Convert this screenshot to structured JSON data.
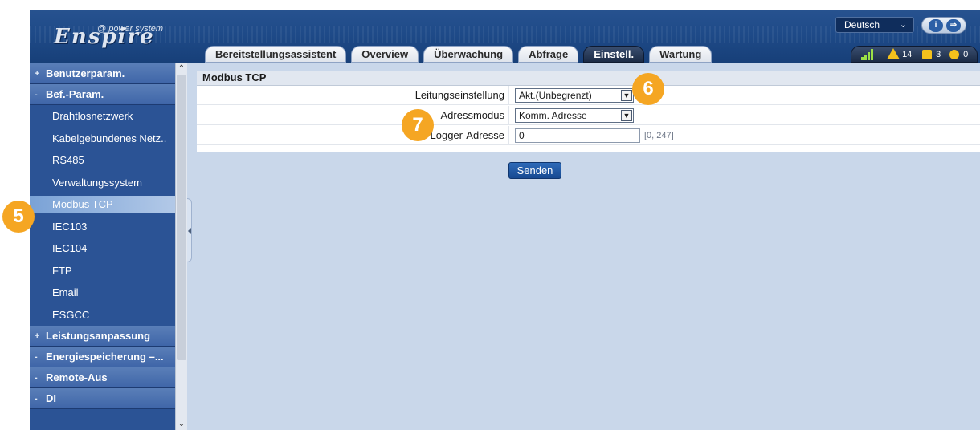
{
  "header": {
    "logo_text": "Enspire",
    "logo_sub": "@ power system",
    "language": "Deutsch",
    "tabs": [
      {
        "label": "Bereitstellungsassistent",
        "active": false
      },
      {
        "label": "Overview",
        "active": false
      },
      {
        "label": "Überwachung",
        "active": false
      },
      {
        "label": "Abfrage",
        "active": false
      },
      {
        "label": "Einstell.",
        "active": true
      },
      {
        "label": "Wartung",
        "active": false
      }
    ],
    "alarms": {
      "major": "14",
      "minor": "3",
      "info": "0"
    }
  },
  "sidebar": {
    "items": [
      {
        "type": "section",
        "label": "Benutzerparam.",
        "mark": "+"
      },
      {
        "type": "section",
        "label": "Bef.-Param.",
        "mark": "-"
      },
      {
        "type": "sub",
        "label": "Drahtlosnetzwerk"
      },
      {
        "type": "sub",
        "label": "Kabelgebundenes Netz.."
      },
      {
        "type": "sub",
        "label": "RS485"
      },
      {
        "type": "sub",
        "label": "Verwaltungssystem"
      },
      {
        "type": "sub",
        "label": "Modbus TCP",
        "active": true
      },
      {
        "type": "sub",
        "label": "IEC103"
      },
      {
        "type": "sub",
        "label": "IEC104"
      },
      {
        "type": "sub",
        "label": "FTP"
      },
      {
        "type": "sub",
        "label": "Email"
      },
      {
        "type": "sub",
        "label": "ESGCC"
      },
      {
        "type": "section",
        "label": "Leistungsanpassung",
        "mark": "+"
      },
      {
        "type": "section",
        "label": "Energiespeicherung –...",
        "mark": "-"
      },
      {
        "type": "section",
        "label": "Remote-Aus",
        "mark": "-"
      },
      {
        "type": "section",
        "label": "DI",
        "mark": "-"
      }
    ]
  },
  "main": {
    "title": "Modbus TCP",
    "fields": {
      "connection": {
        "label": "Leitungseinstellung",
        "value": "Akt.(Unbegrenzt)"
      },
      "address_mode": {
        "label": "Adressmodus",
        "value": "Komm. Adresse"
      },
      "logger_address": {
        "label": "Logger-Adresse",
        "value": "0",
        "range": "[0, 247]"
      }
    },
    "submit_label": "Senden"
  },
  "callouts": [
    "5",
    "6",
    "7"
  ],
  "colors": {
    "accent": "#2b5395",
    "callout": "#f5a623",
    "active_tab": "#1c2b46",
    "content_bg": "#c9d7ea"
  }
}
